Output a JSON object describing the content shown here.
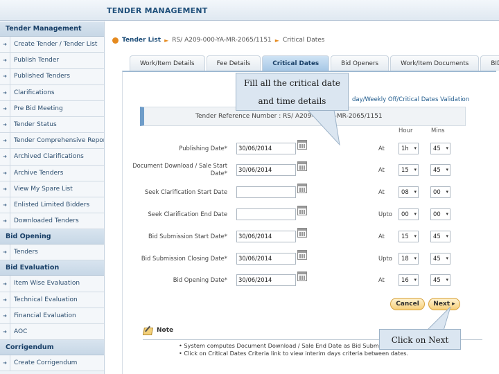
{
  "header": {
    "title": "TENDER MANAGEMENT"
  },
  "sidebar": {
    "sections": [
      {
        "heading": "Tender Management",
        "items": [
          "Create Tender / Tender List",
          "Publish Tender",
          "Published Tenders",
          "Clarifications",
          "Pre Bid Meeting",
          "Tender Status",
          "Tender Comprehensive Report",
          "Archived Clarifications",
          "Archive Tenders",
          "View My Spare List",
          "Enlisted Limited Bidders",
          "Downloaded Tenders"
        ]
      },
      {
        "heading": "Bid Opening",
        "items": [
          "Tenders"
        ]
      },
      {
        "heading": "Bid Evaluation",
        "items": [
          "Item Wise Evaluation",
          "Technical Evaluation",
          "Financial Evaluation",
          "AOC"
        ]
      },
      {
        "heading": "Corrigendum",
        "items": [
          "Create Corrigendum"
        ]
      }
    ]
  },
  "breadcrumb": {
    "home": "Tender List",
    "ref": "RS/ A209-000-YA-MR-2065/1151",
    "current": "Critical Dates"
  },
  "tabs": [
    "Work/Item Details",
    "Fee Details",
    "Critical Dates",
    "Bid Openers",
    "Work/Item Documents",
    "BID"
  ],
  "active_tab": "Critical Dates",
  "validation_link": "day/Weekly Off/Critical Dates Validation",
  "reference": {
    "text": "Tender Reference Number : RS/ A209-000-YA-MR-2065/1151"
  },
  "columns": {
    "hour": "Hour",
    "mins": "Mins"
  },
  "fields": [
    {
      "label": "Publishing Date*",
      "value": "30/06/2014",
      "sep": "At",
      "hour": "1h",
      "min": "45"
    },
    {
      "label": "Document Download / Sale Start Date*",
      "value": "30/06/2014",
      "sep": "At",
      "hour": "15",
      "min": "45"
    },
    {
      "label": "Seek Clarification Start Date",
      "value": "",
      "sep": "At",
      "hour": "08",
      "min": "00"
    },
    {
      "label": "Seek Clarification End Date",
      "value": "",
      "sep": "Upto",
      "hour": "00",
      "min": "00"
    },
    {
      "label": "Bid Submission Start Date*",
      "value": "30/06/2014",
      "sep": "At",
      "hour": "15",
      "min": "45"
    },
    {
      "label": "Bid Submission Closing Date*",
      "value": "30/06/2014",
      "sep": "Upto",
      "hour": "18",
      "min": "45"
    },
    {
      "label": "Bid Opening Date*",
      "value": "30/06/2014",
      "sep": "At",
      "hour": "16",
      "min": "45"
    }
  ],
  "buttons": {
    "cancel": "Cancel",
    "next": "Next ▸"
  },
  "note": {
    "title": "Note",
    "lines": [
      "• System computes Document Download / Sale End Date as Bid Submission Closing Date",
      "• Click on Critical Dates Criteria link to view interim days criteria between dates."
    ]
  },
  "callouts": {
    "fill": "Fill all the critical date and time details",
    "next": "Click on Next"
  }
}
